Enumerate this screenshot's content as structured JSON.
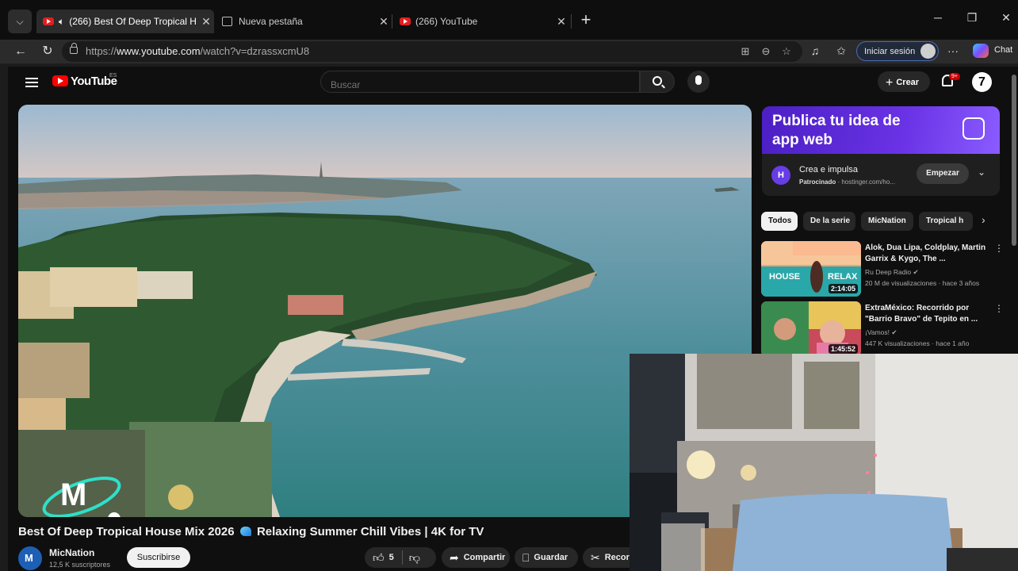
{
  "browser": {
    "tabs": [
      {
        "title": "(266) Best Of Deep Tropical H",
        "active": true,
        "favicon": "youtube-icon"
      },
      {
        "title": "Nueva pestaña",
        "active": false,
        "favicon": "page-icon"
      },
      {
        "title": "(266) YouTube",
        "active": false,
        "favicon": "youtube-icon"
      }
    ],
    "url_prefix": "https://",
    "url_host": "www.youtube.com",
    "url_path": "/watch?v=dzrassxcmU8",
    "signin_label": "Iniciar sesión",
    "chat_label": "Chat"
  },
  "youtube": {
    "logo_text": "YouTube",
    "country_code": "ES",
    "search_placeholder": "Buscar",
    "create_label": "Crear",
    "notifications_badge": "9+",
    "account_initial": "7"
  },
  "video": {
    "title_part1": "Best Of Deep Tropical House Mix 2026",
    "title_part2": "Relaxing Summer Chill Vibes | 4K for TV",
    "channel": "MicNation",
    "subscribers": "12,5 K suscriptores",
    "subscribe_label": "Suscribirse",
    "likes": "5",
    "share_label": "Compartir",
    "save_label": "Guardar",
    "clip_label": "Recort"
  },
  "ad": {
    "headline": "Publica tu idea de app web",
    "title": "Crea e impulsa",
    "sponsored_label": "Patrocinado",
    "domain": "· hostinger.com/ho...",
    "cta": "Empezar",
    "logo_letter": "H"
  },
  "chips": [
    "Todos",
    "De la serie",
    "MicNation",
    "Tropical h"
  ],
  "recommendations": [
    {
      "title": "Alok, Dua Lipa, Coldplay, Martin Garrix & Kygo, The ...",
      "channel": "Ru Deep Radio",
      "meta": "20 M de visualizaciones · hace 3 años",
      "duration": "2:14:05",
      "thumb_text_1": "HOUSE",
      "thumb_text_2": "RELAX"
    },
    {
      "title": "ExtraMéxico: Recorrido por \"Barrio Bravo\" de Tepito en ...",
      "channel": "¡Vamos!",
      "meta": "447 K visualizaciones · hace 1 año",
      "duration": "1:45:52"
    }
  ],
  "colors": {
    "youtube_red": "#ff0000",
    "ad_purple": "#673de6",
    "page_bg": "#0f0f0f"
  }
}
